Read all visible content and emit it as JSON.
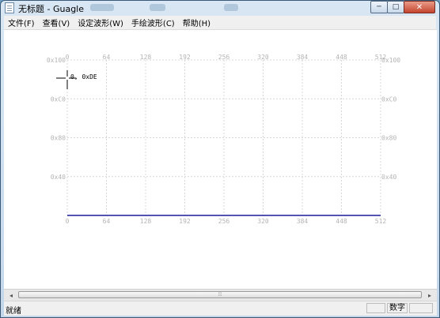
{
  "window": {
    "title": "无标题 - Guagle"
  },
  "title_buttons": {
    "minimize": "─",
    "maximize": "□",
    "close": "✕"
  },
  "menu": [
    "文件(F)",
    "查看(V)",
    "设定波形(W)",
    "手绘波形(C)",
    "帮助(H)"
  ],
  "plot": {
    "x_ticks": [
      "0",
      "64",
      "128",
      "192",
      "256",
      "320",
      "384",
      "448",
      "512"
    ],
    "y_ticks": [
      "0x100",
      "0xC0",
      "0x80",
      "0x40"
    ],
    "cursor_label": "0, 0xDE",
    "line_color": "#1c1c9a",
    "label_color": "#b4b4b4",
    "grid_color": "#d8d8d8"
  },
  "chart_data": {
    "type": "line",
    "x": [
      0,
      512
    ],
    "y": [
      0,
      0
    ],
    "xlim": [
      0,
      512
    ],
    "ylim": [
      0,
      256
    ],
    "x_ticks": [
      0,
      64,
      128,
      192,
      256,
      320,
      384,
      448,
      512
    ],
    "y_ticks": [
      "0x100",
      "0xC0",
      "0x80",
      "0x40"
    ],
    "grid": true
  },
  "scrollbar": {
    "left": "◂",
    "right": "▸",
    "grip": "⦙⦙⦙"
  },
  "status": {
    "text": "就绪",
    "panel_num": "数字"
  }
}
